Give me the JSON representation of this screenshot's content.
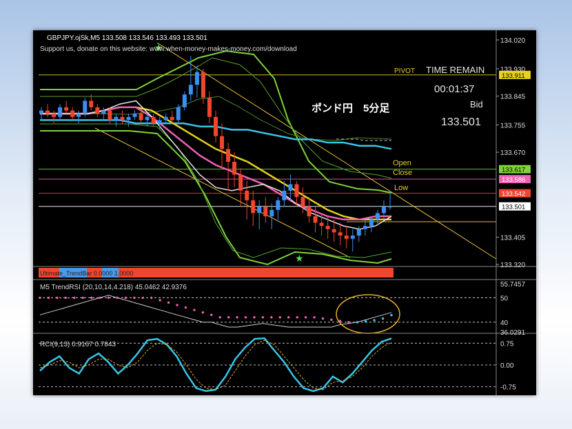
{
  "header": {
    "title": "GBPJPY.ojSk,M5  133.508 133.546 133.493 133.501",
    "notice": "Support us, donate on this website: www.when-money-makes-money.com/download"
  },
  "info": {
    "pivot_label": "PIVOT",
    "time_remain_label": "TIME REMAIN",
    "time_remain": "00:01:37",
    "bid_label": "Bid",
    "bid_value": "133.501",
    "annotation": "ポンド円　5分足",
    "open_label": "Open",
    "close_label": "Close",
    "low_label": "Low"
  },
  "colors": {
    "bull": "#3a8ff0",
    "bear": "#f0452e",
    "cyan": "#39c6e6",
    "yellow": "#e8d21e",
    "pink": "#f062b4",
    "green": "#7fd43a",
    "white": "#e8e8e8"
  },
  "chart_data": [
    {
      "type": "line",
      "name": "price",
      "axis_ticks": [
        "134.020",
        "133.930",
        "133.845",
        "133.755",
        "133.670",
        "133.405",
        "133.320"
      ],
      "ylim": [
        133.32,
        134.02
      ],
      "price_labels": [
        {
          "value": 133.911,
          "text": "133.911",
          "color": "#e8d21e"
        },
        {
          "value": 133.617,
          "text": "133.617",
          "color": "#7fd43a"
        },
        {
          "value": 133.586,
          "text": "133.586",
          "color": "#f062b4"
        },
        {
          "value": 133.542,
          "text": "133.542",
          "color": "#f0452e"
        },
        {
          "value": 133.501,
          "text": "133.501",
          "color": "#ffffff"
        }
      ],
      "candles": [
        [
          133.79,
          133.81,
          133.77,
          133.8
        ],
        [
          133.8,
          133.82,
          133.78,
          133.79
        ],
        [
          133.79,
          133.8,
          133.76,
          133.78
        ],
        [
          133.78,
          133.82,
          133.77,
          133.81
        ],
        [
          133.81,
          133.83,
          133.79,
          133.8
        ],
        [
          133.8,
          133.81,
          133.77,
          133.78
        ],
        [
          133.78,
          133.8,
          133.76,
          133.79
        ],
        [
          133.79,
          133.84,
          133.78,
          133.83
        ],
        [
          133.83,
          133.85,
          133.8,
          133.81
        ],
        [
          133.81,
          133.82,
          133.78,
          133.79
        ],
        [
          133.79,
          133.81,
          133.77,
          133.8
        ],
        [
          133.8,
          133.81,
          133.76,
          133.77
        ],
        [
          133.77,
          133.79,
          133.75,
          133.78
        ],
        [
          133.78,
          133.8,
          133.76,
          133.77
        ],
        [
          133.77,
          133.79,
          133.75,
          133.78
        ],
        [
          133.78,
          133.8,
          133.77,
          133.79
        ],
        [
          133.79,
          133.8,
          133.76,
          133.77
        ],
        [
          133.77,
          133.79,
          133.75,
          133.78
        ],
        [
          133.78,
          133.79,
          133.75,
          133.76
        ],
        [
          133.76,
          133.78,
          133.74,
          133.77
        ],
        [
          133.77,
          133.79,
          133.76,
          133.78
        ],
        [
          133.78,
          133.8,
          133.76,
          133.77
        ],
        [
          133.77,
          133.82,
          133.76,
          133.81
        ],
        [
          133.81,
          133.86,
          133.8,
          133.85
        ],
        [
          133.85,
          133.97,
          133.83,
          133.88
        ],
        [
          133.88,
          133.94,
          133.84,
          133.92
        ],
        [
          133.92,
          133.93,
          133.82,
          133.84
        ],
        [
          133.84,
          133.86,
          133.76,
          133.78
        ],
        [
          133.78,
          133.8,
          133.7,
          133.72
        ],
        [
          133.72,
          133.76,
          133.62,
          133.68
        ],
        [
          133.68,
          133.7,
          133.55,
          133.64
        ],
        [
          133.64,
          133.67,
          133.56,
          133.6
        ],
        [
          133.6,
          133.62,
          133.5,
          133.55
        ],
        [
          133.55,
          133.58,
          133.46,
          133.52
        ],
        [
          133.52,
          133.55,
          133.44,
          133.48
        ],
        [
          133.48,
          133.52,
          133.43,
          133.5
        ],
        [
          133.5,
          133.53,
          133.45,
          133.47
        ],
        [
          133.47,
          133.51,
          133.43,
          133.49
        ],
        [
          133.49,
          133.53,
          133.46,
          133.52
        ],
        [
          133.52,
          133.58,
          133.5,
          133.55
        ],
        [
          133.55,
          133.6,
          133.52,
          133.57
        ],
        [
          133.57,
          133.58,
          133.5,
          133.53
        ],
        [
          133.53,
          133.56,
          133.48,
          133.5
        ],
        [
          133.5,
          133.53,
          133.45,
          133.47
        ],
        [
          133.47,
          133.5,
          133.42,
          133.45
        ],
        [
          133.45,
          133.48,
          133.41,
          133.44
        ],
        [
          133.44,
          133.47,
          133.4,
          133.43
        ],
        [
          133.43,
          133.46,
          133.39,
          133.42
        ],
        [
          133.42,
          133.45,
          133.38,
          133.41
        ],
        [
          133.41,
          133.44,
          133.37,
          133.4
        ],
        [
          133.4,
          133.43,
          133.36,
          133.41
        ],
        [
          133.41,
          133.44,
          133.39,
          133.43
        ],
        [
          133.43,
          133.46,
          133.41,
          133.44
        ],
        [
          133.44,
          133.47,
          133.42,
          133.46
        ],
        [
          133.46,
          133.49,
          133.44,
          133.48
        ],
        [
          133.48,
          133.52,
          133.46,
          133.5
        ],
        [
          133.5,
          133.55,
          133.49,
          133.501
        ]
      ],
      "series": [
        {
          "label": "cyan",
          "color": "#39c6e6",
          "values": [
            133.77,
            133.77,
            133.77,
            133.77,
            133.77,
            133.77,
            133.76,
            133.76,
            133.76,
            133.76,
            133.75,
            133.75,
            133.74,
            133.74,
            133.73,
            133.72,
            133.71,
            133.71,
            133.7,
            133.7,
            133.69,
            133.69,
            133.68
          ]
        },
        {
          "label": "yellow",
          "color": "#e8d21e",
          "values": [
            133.79,
            133.79,
            133.79,
            133.79,
            133.8,
            133.81,
            133.81,
            133.8,
            133.77,
            133.74,
            133.71,
            133.68,
            133.66,
            133.64,
            133.61,
            133.58,
            133.55,
            133.52,
            133.49,
            133.47,
            133.46,
            133.46,
            133.46
          ]
        },
        {
          "label": "pink",
          "color": "#f062b4",
          "values": [
            133.79,
            133.79,
            133.79,
            133.79,
            133.8,
            133.81,
            133.81,
            133.78,
            133.74,
            133.7,
            133.66,
            133.63,
            133.61,
            133.59,
            133.57,
            133.54,
            133.51,
            133.49,
            133.47,
            133.46,
            133.46,
            133.47,
            133.47
          ]
        },
        {
          "label": "white",
          "color": "#e8e8e8",
          "values": [
            133.79,
            133.79,
            133.79,
            133.79,
            133.8,
            133.82,
            133.83,
            133.78,
            133.72,
            133.66,
            133.6,
            133.56,
            133.55,
            133.56,
            133.57,
            133.55,
            133.51,
            133.48,
            133.46,
            133.44,
            133.43,
            133.44,
            133.47
          ]
        }
      ]
    },
    {
      "type": "bar",
      "name": "trend-bar",
      "label": "Ultimate_TrendBar 0.0000 1.0000"
    },
    {
      "type": "line",
      "name": "trend-rsi",
      "label": "M5  TrendRSI (20,10,14,4.218) 45.0462 42.9376",
      "axis_ticks": [
        "55.7457",
        "50",
        "40",
        "36.0291"
      ],
      "ylim": [
        36.0291,
        55.7457
      ],
      "levels": [
        50,
        40
      ],
      "series": [
        {
          "label": "rsi",
          "color": "#cfcfcf",
          "values": [
            43,
            44,
            45,
            46,
            47,
            48,
            49,
            50,
            51,
            50,
            49,
            48,
            47,
            46,
            45,
            44,
            43,
            42,
            41,
            40,
            40,
            39,
            38,
            38,
            38.5,
            39,
            39.5,
            39,
            38.5,
            38,
            38,
            38,
            38,
            38,
            38,
            39,
            39.5,
            40,
            41,
            42,
            43,
            44
          ]
        },
        {
          "label": "signal",
          "color": "#f062b4",
          "style": "dots",
          "values": [
            50,
            50,
            50,
            50,
            50,
            50,
            50,
            50,
            50,
            50,
            50,
            50,
            50,
            50,
            49,
            48,
            47,
            46,
            45,
            44,
            43,
            42,
            42,
            42,
            42,
            42,
            42,
            42,
            42,
            42,
            42,
            42,
            42,
            41.5,
            41,
            40.5,
            40,
            40,
            40.3,
            40.8,
            41.5,
            42.9
          ]
        }
      ]
    },
    {
      "type": "line",
      "name": "rci",
      "label": "RCI(9,13) 0.9167 0.7843",
      "axis_ticks": [
        "0.75",
        "0.00",
        "-0.75"
      ],
      "ylim": [
        -0.95,
        0.95
      ],
      "levels": [
        0.75,
        0,
        -0.75
      ],
      "series": [
        {
          "label": "rci-fast",
          "color": "#39c6e6",
          "values": [
            -0.2,
            0.1,
            0.3,
            -0.1,
            -0.3,
            0.2,
            0.4,
            0.1,
            -0.3,
            0.0,
            0.4,
            0.85,
            0.9,
            0.7,
            0.3,
            -0.3,
            -0.8,
            -0.9,
            -0.85,
            -0.4,
            0.2,
            0.6,
            0.9,
            0.92,
            0.5,
            0.1,
            -0.4,
            -0.8,
            -0.9,
            -0.8,
            -0.4,
            -0.6,
            -0.3,
            0.1,
            0.5,
            0.8,
            0.9167
          ]
        },
        {
          "label": "rci-slow",
          "color": "#e8b02a",
          "style": "dash",
          "values": [
            -0.1,
            0.0,
            0.15,
            0.1,
            -0.1,
            0.0,
            0.2,
            0.2,
            0.0,
            -0.1,
            0.1,
            0.5,
            0.75,
            0.7,
            0.45,
            0.0,
            -0.5,
            -0.8,
            -0.85,
            -0.7,
            -0.2,
            0.3,
            0.7,
            0.85,
            0.7,
            0.3,
            -0.1,
            -0.5,
            -0.8,
            -0.85,
            -0.6,
            -0.55,
            -0.4,
            -0.1,
            0.3,
            0.6,
            0.7843
          ]
        }
      ]
    }
  ]
}
